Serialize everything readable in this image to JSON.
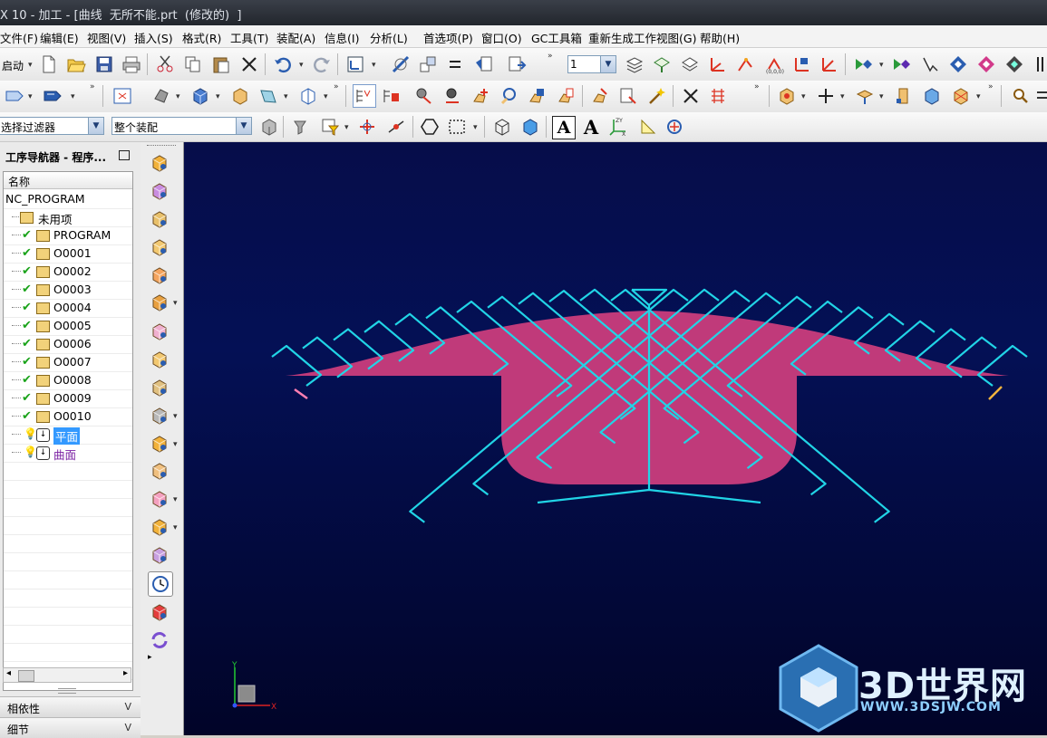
{
  "window": {
    "title": "X 10 - 加工 - [曲线  无所不能.prt  (修改的)  ]"
  },
  "menu": [
    "文件(F)",
    "编辑(E)",
    "视图(V)",
    "插入(S)",
    "格式(R)",
    "工具(T)",
    "装配(A)",
    "信息(I)",
    "分析(L)",
    "首选项(P)",
    "窗口(O)",
    "GC工具箱",
    "重新生成工作视图(G)",
    "帮助(H)"
  ],
  "toolbar": {
    "start_label": "启动",
    "layer_value": "1",
    "selection_filter": "选择过滤器",
    "assembly_scope": "整个装配",
    "text_a_label": "A"
  },
  "navigator": {
    "title": "工序导航器 - 程序...",
    "column_name": "名称",
    "root": "NC_PROGRAM",
    "items": [
      {
        "label": "未用项",
        "status": "none",
        "color": "#000000"
      },
      {
        "label": "PROGRAM",
        "status": "check",
        "color": "#000000"
      },
      {
        "label": "O0001",
        "status": "check",
        "color": "#000000"
      },
      {
        "label": "O0002",
        "status": "check",
        "color": "#000000"
      },
      {
        "label": "O0003",
        "status": "check",
        "color": "#000000"
      },
      {
        "label": "O0004",
        "status": "check",
        "color": "#000000"
      },
      {
        "label": "O0005",
        "status": "check",
        "color": "#000000"
      },
      {
        "label": "O0006",
        "status": "check",
        "color": "#000000"
      },
      {
        "label": "O0007",
        "status": "check",
        "color": "#000000"
      },
      {
        "label": "O0008",
        "status": "check",
        "color": "#000000"
      },
      {
        "label": "O0009",
        "status": "check",
        "color": "#000000"
      },
      {
        "label": "O0010",
        "status": "check",
        "color": "#000000"
      },
      {
        "label": "平面",
        "status": "warn",
        "color": "#7a1fa2",
        "selected": true
      },
      {
        "label": "曲面",
        "status": "warn",
        "color": "#7a1fa2"
      }
    ]
  },
  "panels": {
    "dependencies": "相依性",
    "details": "细节"
  },
  "viewport": {
    "background": "#040c4a",
    "part_fill": "#c03a7a",
    "toolpath_color": "#21d4e6",
    "axis_labels": {
      "x": "X",
      "y": "Y"
    }
  },
  "watermark": {
    "brand": "3D世界网",
    "url": "WWW.3DSJW.COM"
  }
}
